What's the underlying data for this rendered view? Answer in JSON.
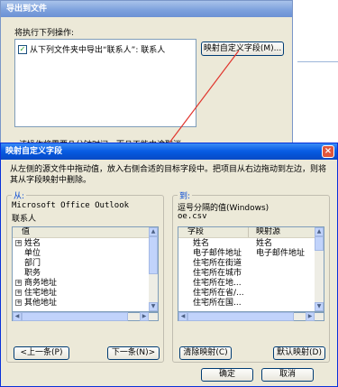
{
  "export_dialog": {
    "title": "导出到文件",
    "prompt": "将执行下列操作:",
    "action_item": "从下列文件夹中导出“联系人”: 联系人",
    "map_button": "映射自定义字段(M)...",
    "note": "该操作将需要几分钟时间，而且不能中途取消。"
  },
  "map_dialog": {
    "title": "映射自定义字段",
    "close_glyph": "×",
    "instructions": "从左侧的源文件中拖动值，放入右侧合适的目标字段中。把项目从右边拖动到左边，则将其从字段映射中删除。",
    "from": {
      "label": "从:",
      "source": "Microsoft Office Outlook",
      "folder": "联系人",
      "header": "值",
      "items": [
        {
          "expand": "+",
          "label": "姓名"
        },
        {
          "expand": "",
          "label": "单位"
        },
        {
          "expand": "",
          "label": "部门"
        },
        {
          "expand": "",
          "label": "职务"
        },
        {
          "expand": "+",
          "label": "商务地址"
        },
        {
          "expand": "+",
          "label": "住宅地址"
        },
        {
          "expand": "+",
          "label": "其他地址"
        }
      ],
      "prev_button": "<上一条(P)",
      "next_button": "下一条(N)>"
    },
    "to": {
      "label": "到:",
      "target": "逗号分隔的值(Windows)",
      "file": "oe.csv",
      "col_field": "字段",
      "col_mapped": "映射源",
      "rows": [
        {
          "field": "姓名",
          "mapped": "姓名"
        },
        {
          "field": "电子邮件地址",
          "mapped": "电子邮件地址"
        },
        {
          "field": "住宅所在街道",
          "mapped": ""
        },
        {
          "field": "住宅所在城市",
          "mapped": ""
        },
        {
          "field": "住宅所在地...",
          "mapped": ""
        },
        {
          "field": "住宅所在省/...",
          "mapped": ""
        },
        {
          "field": "住宅所在国...",
          "mapped": ""
        }
      ],
      "clear_button": "清除映射(C)",
      "default_button": "默认映射(D)"
    },
    "ok_button": "确定",
    "cancel_button": "取消"
  },
  "colors": {
    "arrow": "#e0342c",
    "accent": "#0a5ee4"
  }
}
